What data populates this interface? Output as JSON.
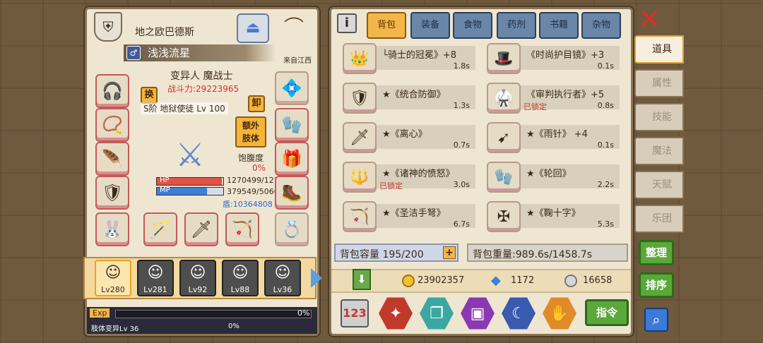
{
  "character": {
    "title": "地之欧巴德斯",
    "name": "浅浅流星",
    "origin": "来自江西",
    "class_line": "变异人 魔战士",
    "power": "战斗力:29223965",
    "swap_label": "换",
    "unequip_label": "卸",
    "rank_line": "S阶 地狱使徒 Lv 100",
    "extra_body_label": "额外\n肢体",
    "satiety_label": "饱腹度",
    "satiety_value": "0%",
    "hp_label": "HP",
    "mp_label": "MP",
    "hp_value": "1270499/127",
    "mp_value": "379549/5060",
    "shield_value": "盾:10364808",
    "hp_fill": 0.98,
    "mp_fill": 0.75
  },
  "party": [
    {
      "level": "Lv280",
      "icon": "silver-hair-hero-icon"
    },
    {
      "level": "Lv281",
      "icon": "horned-hero-icon"
    },
    {
      "level": "Lv92",
      "icon": "grey-hero-icon"
    },
    {
      "level": "Lv88",
      "icon": "grey-hero-icon"
    },
    {
      "level": "Lv36",
      "icon": "grey-hero-icon"
    }
  ],
  "exp": {
    "label": "Exp",
    "value": "0%",
    "sub_label": "肢体变异Lv 36",
    "sub_value": "0%"
  },
  "tabs": [
    "背包",
    "装备",
    "食物",
    "药剂",
    "书籍",
    "杂物"
  ],
  "info_label": "i",
  "items": [
    {
      "name": "└骑士的冠冕》+8",
      "weight": "1.8s",
      "locked": "",
      "icon": "crown-icon"
    },
    {
      "name": "《时尚护目镜》+3",
      "weight": "0.1s",
      "locked": "",
      "icon": "goggles-hat-icon"
    },
    {
      "name": "★《统合防御》",
      "weight": "1.3s",
      "locked": "",
      "icon": "shield-gem-icon"
    },
    {
      "name": "《审判执行者》+5",
      "weight": "0.8s",
      "locked": "已锁定",
      "icon": "robe-icon"
    },
    {
      "name": "★《离心》",
      "weight": "0.7s",
      "locked": "",
      "icon": "sword-icon"
    },
    {
      "name": "★《雨针》 +4",
      "weight": "0.1s",
      "locked": "",
      "icon": "needle-icon"
    },
    {
      "name": "★《诸神的愤怒》",
      "weight": "3.0s",
      "locked": "已锁定",
      "icon": "spear-icon"
    },
    {
      "name": "★《轮回》",
      "weight": "2.2s",
      "locked": "",
      "icon": "gauntlet-icon"
    },
    {
      "name": "★《圣洁手弩》",
      "weight": "6.7s",
      "locked": "",
      "icon": "crossbow-icon"
    },
    {
      "name": "★《鞠十字》",
      "weight": "5.3s",
      "locked": "",
      "icon": "cross-icon"
    }
  ],
  "capacity": "背包容量 195/200",
  "weight": "背包重量:989.6s/1458.7s",
  "currency": {
    "gold": "23902357",
    "gems": "1172",
    "silver": "16658"
  },
  "side_tabs": [
    "道具",
    "属性",
    "技能",
    "魔法",
    "天赋",
    "乐团"
  ],
  "buttons": {
    "organize": "整理",
    "sort": "排序",
    "command": "指令"
  },
  "colors": {
    "panel": "#efe6d2",
    "tab_active": "#f3b648",
    "tab_inactive": "#6a86a8",
    "lock_text": "#c0392b",
    "power_text": "#d0342c",
    "hp": "#e0524a",
    "mp": "#3f7fd8"
  }
}
